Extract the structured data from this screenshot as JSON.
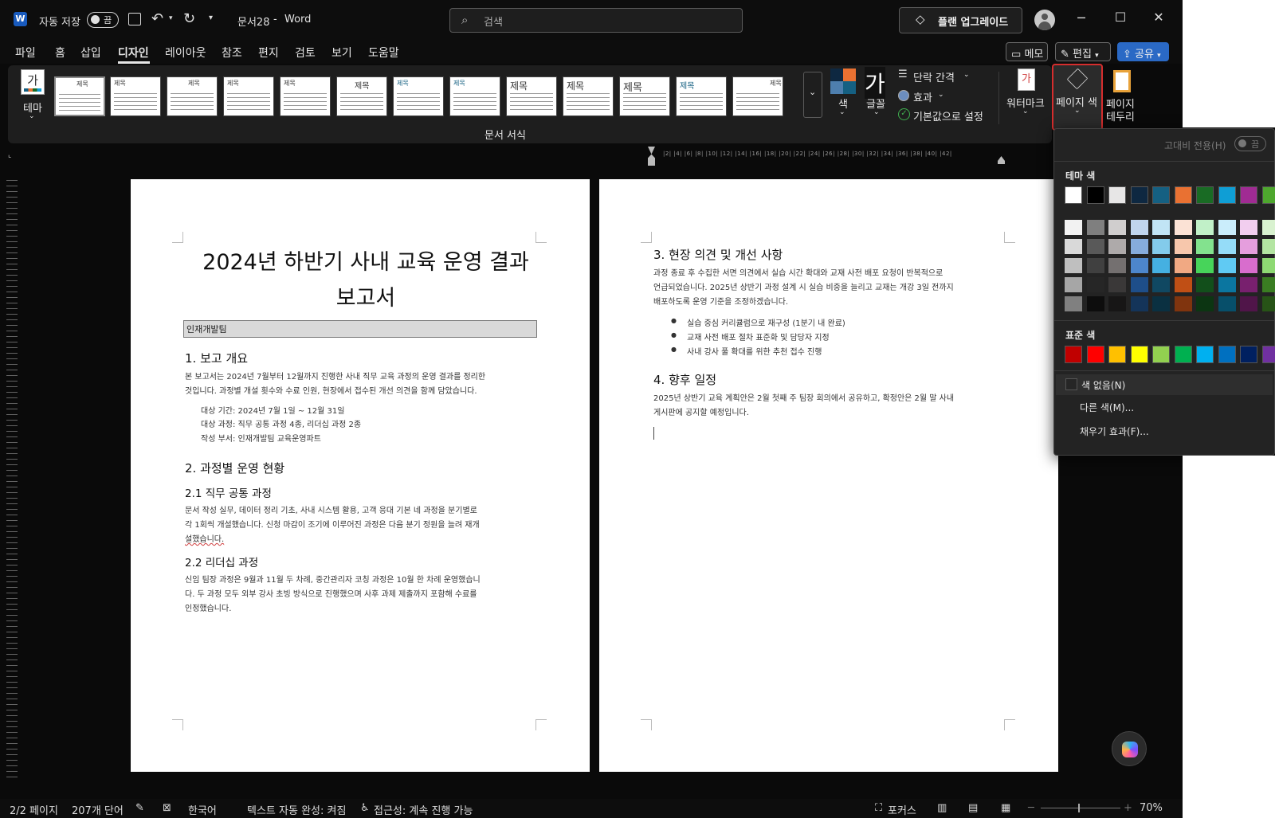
{
  "titlebar": {
    "autosave_label": "자동 저장",
    "autosave_state": "끔",
    "doc_name": "문서28",
    "separator": "-",
    "app_name": "Word",
    "search_placeholder": "검색",
    "upgrade_label": "플랜 업그레이드"
  },
  "menu": {
    "items": [
      "파일",
      "홈",
      "삽입",
      "디자인",
      "레이아웃",
      "참조",
      "편지",
      "검토",
      "보기",
      "도움말"
    ],
    "active": "디자인",
    "memo": "메모",
    "edit": "편집",
    "share": "공유"
  },
  "ribbon": {
    "theme_label": "테마",
    "theme_icon_text": "가",
    "style_thumb_title": "제목",
    "group_label": "문서 서식",
    "colors_label": "색",
    "fonts_label": "글꼴",
    "fonts_icon_text": "가",
    "paragraph_spacing": "단락 간격",
    "effects": "효과",
    "set_default": "기본값으로 설정",
    "watermark": "워터마크",
    "watermark_icon_text": "가",
    "page_color": "페이지 색",
    "page_borders_line1": "페이지",
    "page_borders_line2": "테두리"
  },
  "ruler": {
    "ticks": "|2| |4| |6| |8| |10| |12| |14| |16| |18| |20| |22| |24| |26| |28| |30| |32| |34| |36| |38| |40| |42|"
  },
  "page1": {
    "title_line1": "2024년 하반기 사내 교육 운영 결과",
    "title_line2": "보고서",
    "team": "인재개발팀",
    "s1_heading": "1. 보고 개요",
    "s1_para_l1": "본 보고서는 2024년 7월부터 12월까지 진행한 사내 직무 교육 과정의 운영 결과를 정리한",
    "s1_para_l2": "것입니다. 과정별 개설 횟수와 수료 인원, 현장에서 접수된 개선 의견을 함께 담았습니다.",
    "s1_meta": [
      "대상 기간: 2024년 7월 1일 ~ 12월 31일",
      "대상 과정: 직무 공통 과정 4종, 리더십 과정 2종",
      "작성 부서: 인재개발팀 교육운영파트"
    ],
    "s2_heading": "2. 과정별 운영 현황",
    "s21_heading": "2.1 직무 공통 과정",
    "s21_para": [
      "문서 작성 실무, 데이터 정리 기초, 사내 시스템 활용, 고객 응대 기본 네 과정을 분기별로",
      "각 1회씩 개설했습니다. 신청 마감이 조기에 이루어진 과정은 다음 분기 정원을 늘려 재개",
      "설했습니다."
    ],
    "s22_heading": "2.2 리더십 과정",
    "s22_para": [
      "신임 팀장 과정은 9월과 11월 두 차례, 중간관리자 코칭 과정은 10월 한 차례 운영했습니",
      "다. 두 과정 모두 외부 강사 초빙 방식으로 진행했으며 사후 과제 제출까지 포함해 수료를",
      "인정했습니다."
    ]
  },
  "page2": {
    "s3_heading": "3. 현장 의견 및 개선 사항",
    "s3_para": [
      "과정 종료 후 수집한 서면 의견에서 실습 시간 확대와 교재 사전 배포 요청이 반복적으로",
      "언급되었습니다. 2025년 상반기 과정 설계 시 실습 비중을 늘리고 교재는 개강 3일 전까지",
      "배포하도록 운영 기준을 조정하겠습니다."
    ],
    "bullets": [
      "실습 중심 커리큘럼으로 재구성 (1분기 내 완료)",
      "교재 사전 배포 절차 표준화 및 담당자 지정",
      "사내 강사 풀 확대를 위한 추천 접수 진행"
    ],
    "s4_heading": "4. 향후 일정",
    "s4_para": [
      "2025년 상반기 교육 계획안은 2월 첫째 주 팀장 회의에서 공유하고, 확정안은 2월 말 사내",
      "게시판에 공지할 예정입니다."
    ]
  },
  "dropdown": {
    "high_contrast_label": "고대비 전용(H)",
    "high_contrast_state": "끔",
    "theme_colors_label": "테마 색",
    "standard_colors_label": "표준 색",
    "no_color": "색 없음(N)",
    "more_colors": "다른 색(M)...",
    "fill_effects": "채우기 효과(F)...",
    "theme_colors": [
      "#ffffff",
      "#000000",
      "#e7e6e6",
      "#0e2841",
      "#156082",
      "#e97132",
      "#196b24",
      "#0f9ed5",
      "#a02b93",
      "#4ea72e"
    ],
    "theme_shades": [
      [
        "#f2f2f2",
        "#7f7f7f",
        "#d0cece",
        "#c0d5ee",
        "#c1e4f5",
        "#fbe2d5",
        "#c1f0c8",
        "#caedfb",
        "#f2ceef",
        "#d9f2d0"
      ],
      [
        "#d9d9d9",
        "#595959",
        "#aeaaaa",
        "#86acdc",
        "#83cbeb",
        "#f7c7ac",
        "#83e28e",
        "#95dcf8",
        "#e59edd",
        "#b4e5a2"
      ],
      [
        "#bfbfbf",
        "#404040",
        "#747070",
        "#4d86cb",
        "#45b0e1",
        "#f1a983",
        "#47d45a",
        "#60caf3",
        "#d86dcd",
        "#8ed973"
      ],
      [
        "#a6a6a6",
        "#262626",
        "#3a3838",
        "#1e4e89",
        "#104862",
        "#c04f15",
        "#124f1b",
        "#0b76a0",
        "#78206e",
        "#3a7d22"
      ],
      [
        "#808080",
        "#0d0d0d",
        "#171616",
        "#143459",
        "#0a3041",
        "#80340e",
        "#0c3512",
        "#074f6a",
        "#501549",
        "#275317"
      ]
    ],
    "standard_colors": [
      "#c00000",
      "#ff0000",
      "#ffc000",
      "#ffff00",
      "#92d050",
      "#00b050",
      "#00b0f0",
      "#0070c0",
      "#002060",
      "#7030a0"
    ]
  },
  "status": {
    "page": "2/2 페이지",
    "words": "207개 단어",
    "language": "한국어",
    "autocomplete": "텍스트 자동 완성: 켜짐",
    "accessibility": "접근성: 계속 진행 가능",
    "focus": "포커스",
    "zoom": "70%"
  },
  "colors": {
    "accent_red": "#d62d2d",
    "share_blue": "#2a69c5"
  }
}
